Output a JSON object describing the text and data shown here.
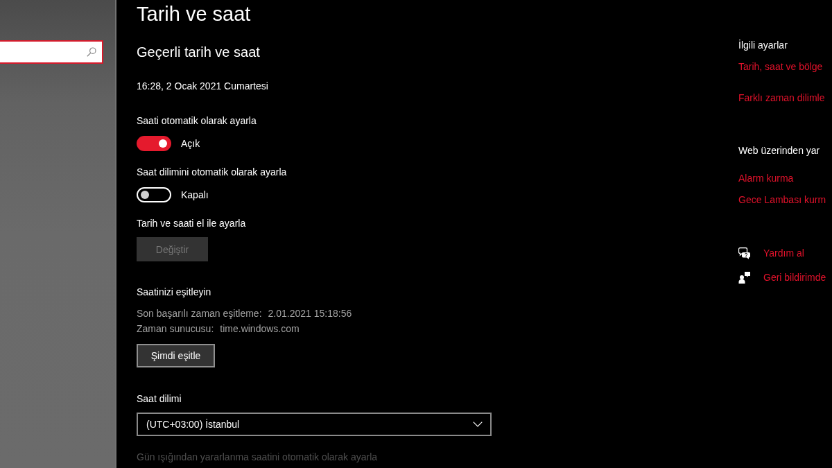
{
  "sidebar": {
    "search": {
      "focused": true
    }
  },
  "page": {
    "title": "Tarih ve saat"
  },
  "current": {
    "heading": "Geçerli tarih ve saat",
    "datetime": "16:28, 2 Ocak 2021 Cumartesi"
  },
  "settings": [
    {
      "kind": "toggle",
      "label": "Saati otomatik olarak ayarla",
      "on": true,
      "state_text": "Açık"
    },
    {
      "kind": "toggle",
      "label": "Saat dilimini otomatik olarak ayarla",
      "on": false,
      "state_text": "Kapalı"
    },
    {
      "kind": "button",
      "label": "Tarih ve saati el ile ayarla",
      "button": {
        "label": "Değiştir",
        "disabled": true
      }
    }
  ],
  "sync": {
    "heading": "Saatinizi eşitleyin",
    "details": [
      {
        "label": "Son başarılı zaman eşitleme:",
        "value": "2.01.2021 15:18:56"
      },
      {
        "label": "Zaman sunucusu:",
        "value": "time.windows.com"
      }
    ],
    "button": {
      "label": "Şimdi eşitle",
      "disabled": false
    }
  },
  "time_zone": {
    "label": "Saat dilimi",
    "value": "(UTC+03:00) İstanbul"
  },
  "daylight_saving": {
    "label": "Gün ışığından yararlanma saatini otomatik olarak ayarla",
    "disabled": true
  },
  "related": [
    {
      "heading": "İlgili ayarlar",
      "links": [
        "Tarih, saat ve bölge",
        "Farklı zaman dilimle"
      ]
    },
    {
      "heading": "Web üzerinden yar",
      "links": [
        "Alarm kurma",
        "Gece Lambası kurm"
      ]
    }
  ],
  "support": [
    {
      "kind": "help",
      "label": "Yardım al"
    },
    {
      "kind": "feedback",
      "label": "Geri bildirimde"
    }
  ]
}
